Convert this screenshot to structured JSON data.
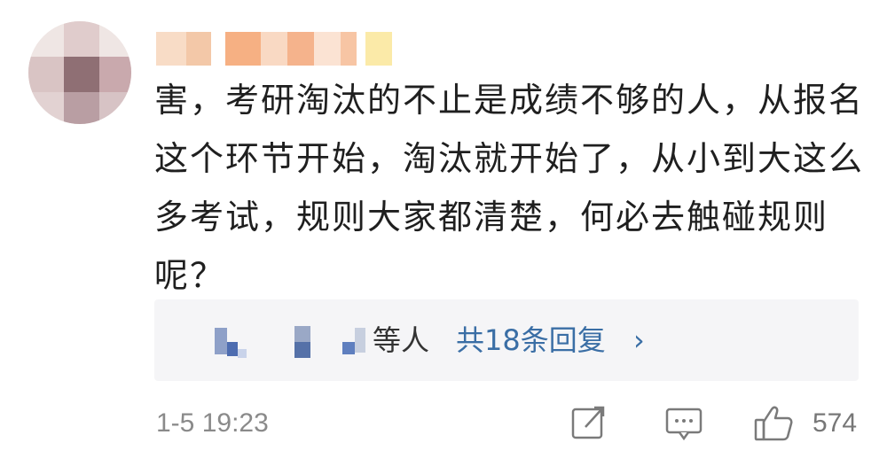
{
  "comment": {
    "author_name": "",
    "text": "害，考研淘汰的不止是成绩不够的人，从报名这个环节开始，淘汰就开始了，从小到大这么多考试，规则大家都清楚，何必去触碰规则呢？",
    "timestamp": "1-5 19:23",
    "like_count": "574"
  },
  "replies": {
    "names_suffix": "等人",
    "count_label": "共18条回复",
    "chevron": "›"
  },
  "icons": {
    "share": "share-icon",
    "reply": "comment-icon",
    "like": "thumbs-up-icon"
  },
  "colors": {
    "link": "#3a6ea5",
    "meta": "#8a8a8a",
    "reply_bg": "#f5f5f7"
  }
}
